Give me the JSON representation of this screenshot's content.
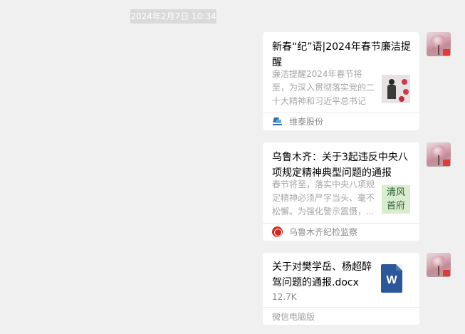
{
  "chat": {
    "timestamp": "2024年2月7日 10:34",
    "messages": [
      {
        "type": "article",
        "title": "新春“纪”语|2024年春节廉洁提醒",
        "description": "廉洁提醒2024年春节将至，为深入贯彻落实党的二十大精神和习近平总书记关...",
        "source": "维泰股份"
      },
      {
        "type": "article",
        "title": "乌鲁木齐：关于3起违反中央八项规定精神典型问题的通报",
        "description": "春节将至，落实中央八项规定精神必须严字当头、毫不松懈。为强化警示震慑，...",
        "thumbnail_text": [
          "清风",
          "首府"
        ],
        "source": "乌鲁木齐纪检监察"
      },
      {
        "type": "file",
        "title": "关于对樊学岳、杨超醉驾问题的通报.docx",
        "file_size": "12.7K",
        "file_icon_letter": "W",
        "source": "微信电脑版"
      }
    ]
  },
  "colors": {
    "background": "#f0f0f0",
    "card": "#ffffff",
    "word_blue": "#2b579a"
  }
}
